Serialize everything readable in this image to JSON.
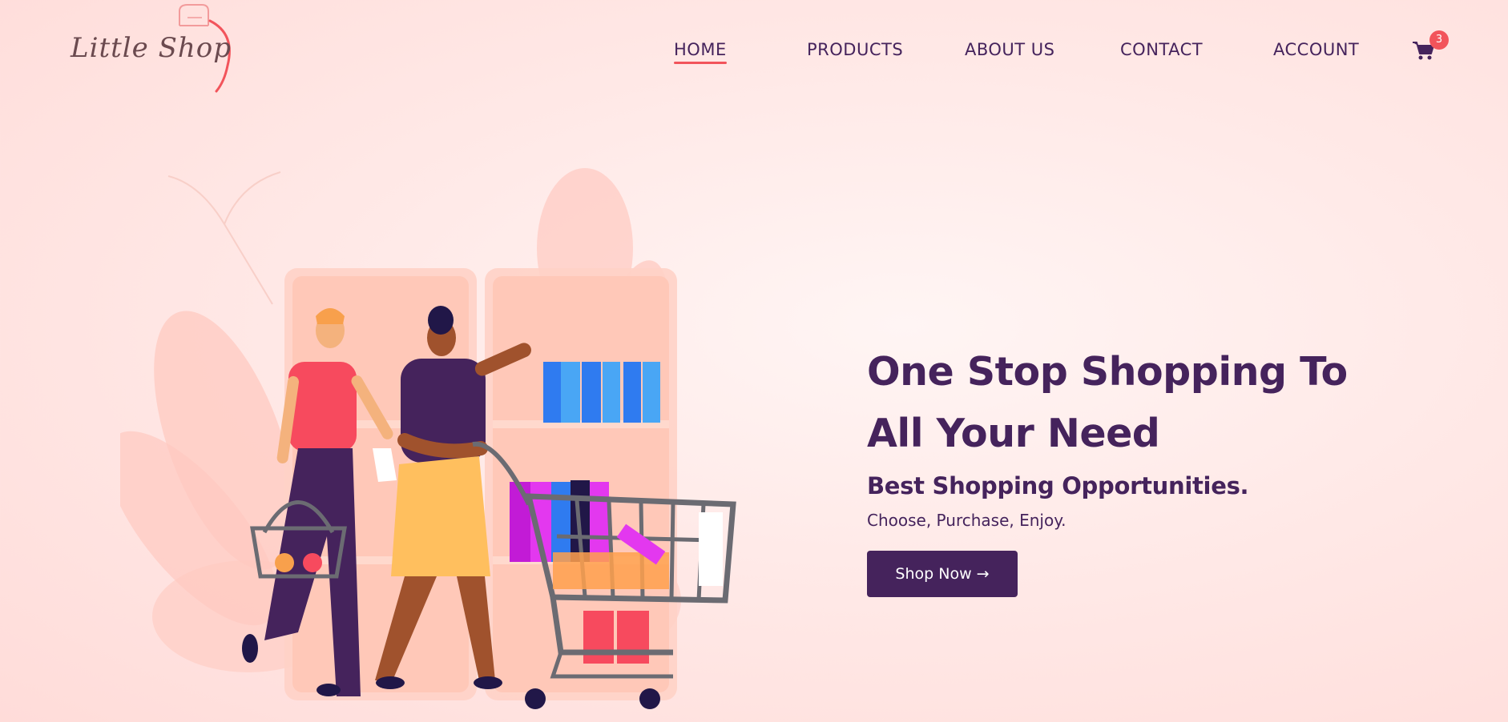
{
  "brand": {
    "logo_text": "Little Shop"
  },
  "nav": {
    "items": [
      {
        "label": "HOME",
        "active": true
      },
      {
        "label": "PRODUCTS",
        "active": false
      },
      {
        "label": "ABOUT US",
        "active": false
      },
      {
        "label": "CONTACT",
        "active": false
      },
      {
        "label": "ACCOUNT",
        "active": false
      }
    ],
    "cart_count": "3",
    "cart_icon": "shopping-cart-icon"
  },
  "hero": {
    "headline_line1": "One Stop Shopping To",
    "headline_line2": "All Your Need",
    "subheadline": "Best Shopping Opportunities.",
    "tagline": "Choose, Purchase, Enjoy.",
    "cta_label": "Shop Now →"
  },
  "colors": {
    "primary": "#45235c",
    "accent": "#f2545b",
    "background": "#ffe9e7"
  }
}
